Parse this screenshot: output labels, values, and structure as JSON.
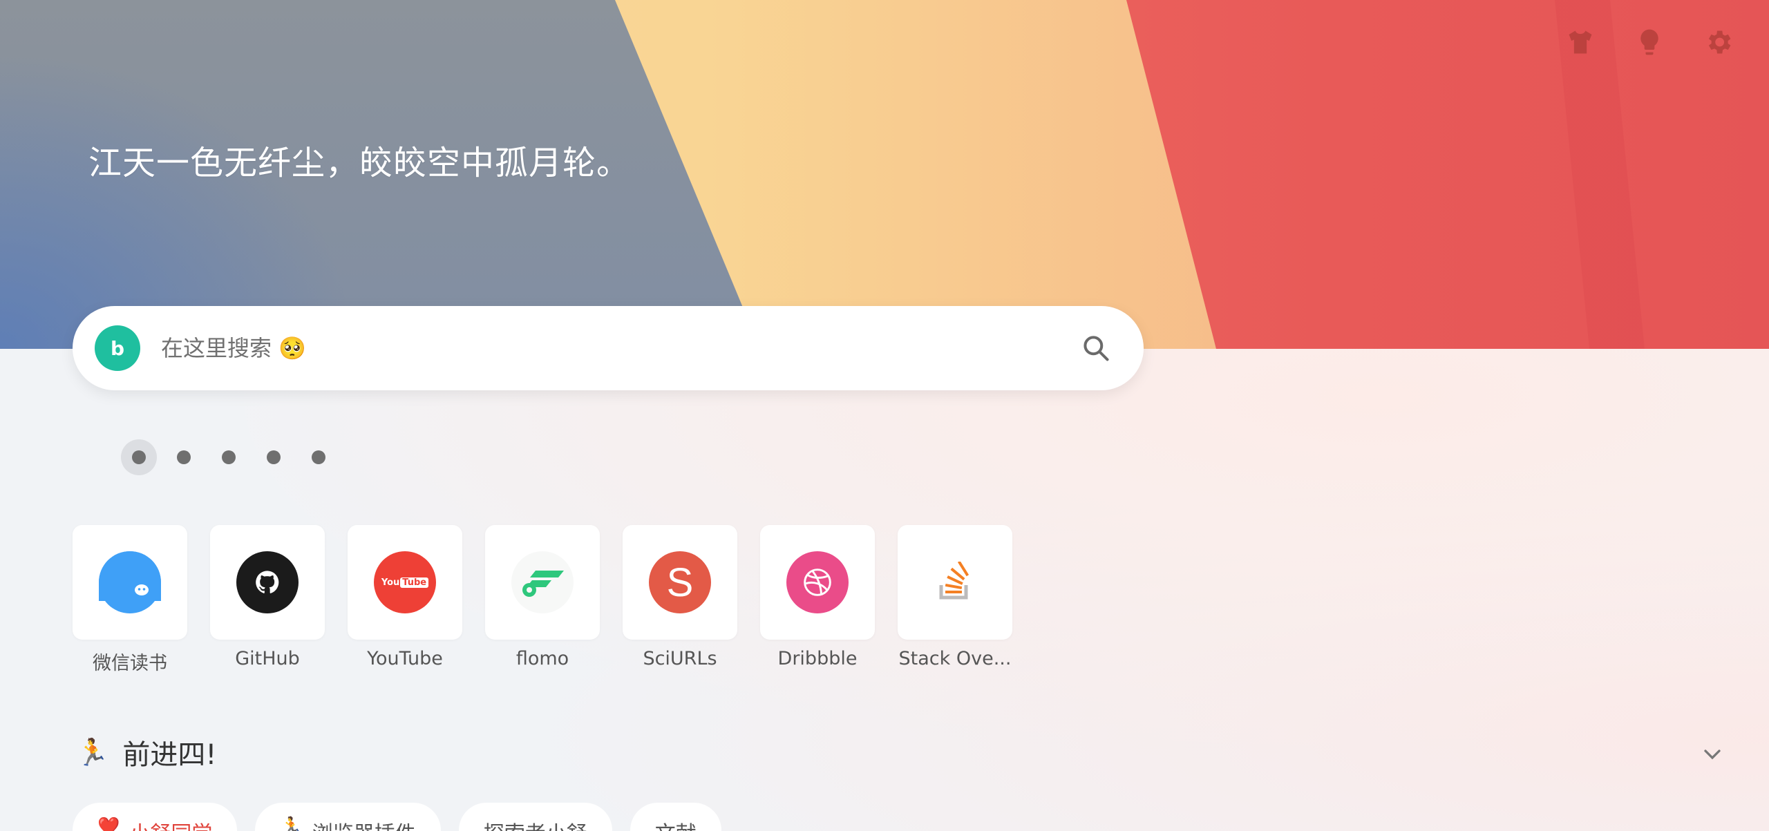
{
  "header": {
    "quote": "江天一色无纤尘，皎皎空中孤月轮。",
    "icons": [
      "shirt-icon",
      "lightbulb-icon",
      "gear-icon"
    ]
  },
  "search": {
    "engine_letter": "b",
    "engine_color": "#1fbf9f",
    "placeholder": "在这里搜索 🥺"
  },
  "pager": {
    "count": 5,
    "active_index": 0
  },
  "shortcuts": [
    {
      "label": "微信读书",
      "color": "#3fa0f7"
    },
    {
      "label": "GitHub",
      "color": "#1b1b1b"
    },
    {
      "label": "YouTube",
      "color": "#ee4036",
      "badge": "YouTube"
    },
    {
      "label": "flomo",
      "color": "#2ec77c"
    },
    {
      "label": "SciURLs",
      "color": "#e35a47",
      "badge": "S"
    },
    {
      "label": "Dribbble",
      "color": "#ea4c89"
    },
    {
      "label": "Stack Ove...",
      "color": "#f48024"
    }
  ],
  "section": {
    "emoji": "🏃",
    "title": "前进四!"
  },
  "tabs": [
    {
      "icon": "❤️",
      "label": "小舒同学",
      "active": true
    },
    {
      "icon": "🏃",
      "label": "浏览器插件",
      "active": false
    },
    {
      "icon": "",
      "label": "探索者小舒",
      "active": false
    },
    {
      "icon": "",
      "label": "文献",
      "active": false
    }
  ],
  "colors": {
    "accent_red": "#e0443c",
    "icon_red": "#b8403c"
  }
}
